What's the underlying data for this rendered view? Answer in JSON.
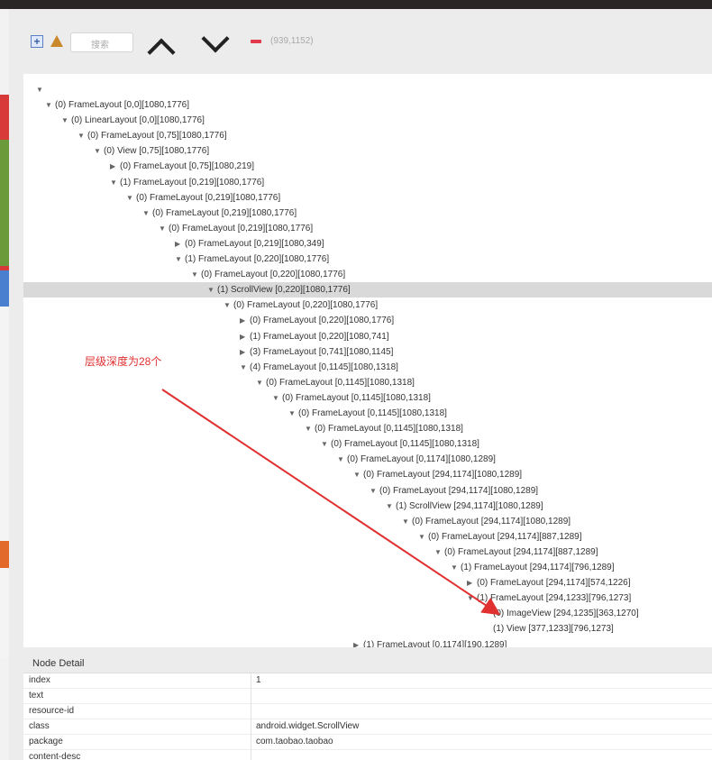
{
  "toolbar": {
    "search_placeholder": "搜索",
    "coordinates": "(939,1152)",
    "icons": [
      "expand-icon",
      "warning-icon",
      "chevron-up-icon",
      "chevron-down-icon",
      "minus-icon"
    ]
  },
  "tree": {
    "root_marker": "▼",
    "rows": [
      {
        "tri": "▼",
        "text": "(0) FrameLayout [0,0][1080,1776]"
      },
      {
        "tri": "▼",
        "text": "(0) LinearLayout [0,0][1080,1776]"
      },
      {
        "tri": "▼",
        "text": "(0) FrameLayout [0,75][1080,1776]"
      },
      {
        "tri": "▼",
        "text": "(0) View [0,75][1080,1776]"
      },
      {
        "tri": "▶",
        "text": "(0) FrameLayout [0,75][1080,219]"
      },
      {
        "tri": "▼",
        "text": "(1) FrameLayout [0,219][1080,1776]"
      },
      {
        "tri": "▼",
        "text": "(0) FrameLayout [0,219][1080,1776]"
      },
      {
        "tri": "▼",
        "text": "(0) FrameLayout [0,219][1080,1776]"
      },
      {
        "tri": "▼",
        "text": "(0) FrameLayout [0,219][1080,1776]"
      },
      {
        "tri": "▶",
        "text": "(0) FrameLayout [0,219][1080,349]"
      },
      {
        "tri": "▼",
        "text": "(1) FrameLayout [0,220][1080,1776]"
      },
      {
        "tri": "▼",
        "text": "(0) FrameLayout [0,220][1080,1776]"
      },
      {
        "tri": "▼",
        "text": "(1) ScrollView [0,220][1080,1776]"
      },
      {
        "tri": "▼",
        "text": "(0) FrameLayout [0,220][1080,1776]"
      },
      {
        "tri": "▶",
        "text": "(0) FrameLayout [0,220][1080,1776]"
      },
      {
        "tri": "▶",
        "text": "(1) FrameLayout [0,220][1080,741]"
      },
      {
        "tri": "▶",
        "text": "(3) FrameLayout [0,741][1080,1145]"
      },
      {
        "tri": "▼",
        "text": "(4) FrameLayout [0,1145][1080,1318]"
      },
      {
        "tri": "▼",
        "text": "(0) FrameLayout [0,1145][1080,1318]"
      },
      {
        "tri": "▼",
        "text": "(0) FrameLayout [0,1145][1080,1318]"
      },
      {
        "tri": "▼",
        "text": "(0) FrameLayout [0,1145][1080,1318]"
      },
      {
        "tri": "▼",
        "text": "(0) FrameLayout [0,1145][1080,1318]"
      },
      {
        "tri": "▼",
        "text": "(0) FrameLayout [0,1145][1080,1318]"
      },
      {
        "tri": "▼",
        "text": "(0) FrameLayout [0,1174][1080,1289]"
      },
      {
        "tri": "▼",
        "text": "(0) FrameLayout [294,1174][1080,1289]"
      },
      {
        "tri": "▼",
        "text": "(0) FrameLayout [294,1174][1080,1289]"
      },
      {
        "tri": "▼",
        "text": "(1) ScrollView [294,1174][1080,1289]"
      },
      {
        "tri": "▼",
        "text": "(0) FrameLayout [294,1174][1080,1289]"
      },
      {
        "tri": "▼",
        "text": "(0) FrameLayout [294,1174][887,1289]"
      },
      {
        "tri": "▼",
        "text": "(0) FrameLayout [294,1174][887,1289]"
      },
      {
        "tri": "▼",
        "text": "(1) FrameLayout [294,1174][796,1289]"
      },
      {
        "tri": "▶",
        "text": "(0) FrameLayout [294,1174][574,1226]"
      },
      {
        "tri": "▼",
        "text": "(1) FrameLayout [294,1233][796,1273]"
      },
      {
        "tri": "",
        "text": "(0) ImageView [294,1235][363,1270]"
      },
      {
        "tri": "",
        "text": "(1) View [377,1233][796,1273]"
      },
      {
        "tri": "▶",
        "text": "(1) FrameLayout [0,1174][190,1289]"
      }
    ]
  },
  "annotation": {
    "text": "层级深度为28个"
  },
  "detail": {
    "header": "Node Detail",
    "rows": [
      {
        "key": "index",
        "value": "1"
      },
      {
        "key": "text",
        "value": ""
      },
      {
        "key": "resource-id",
        "value": ""
      },
      {
        "key": "class",
        "value": "android.widget.ScrollView"
      },
      {
        "key": "package",
        "value": "com.taobao.taobao"
      },
      {
        "key": "content-desc",
        "value": ""
      }
    ]
  },
  "colors": {
    "annotation": "#e03030",
    "selected_row": "#d9d9d9",
    "panel_bg": "#ececec"
  }
}
